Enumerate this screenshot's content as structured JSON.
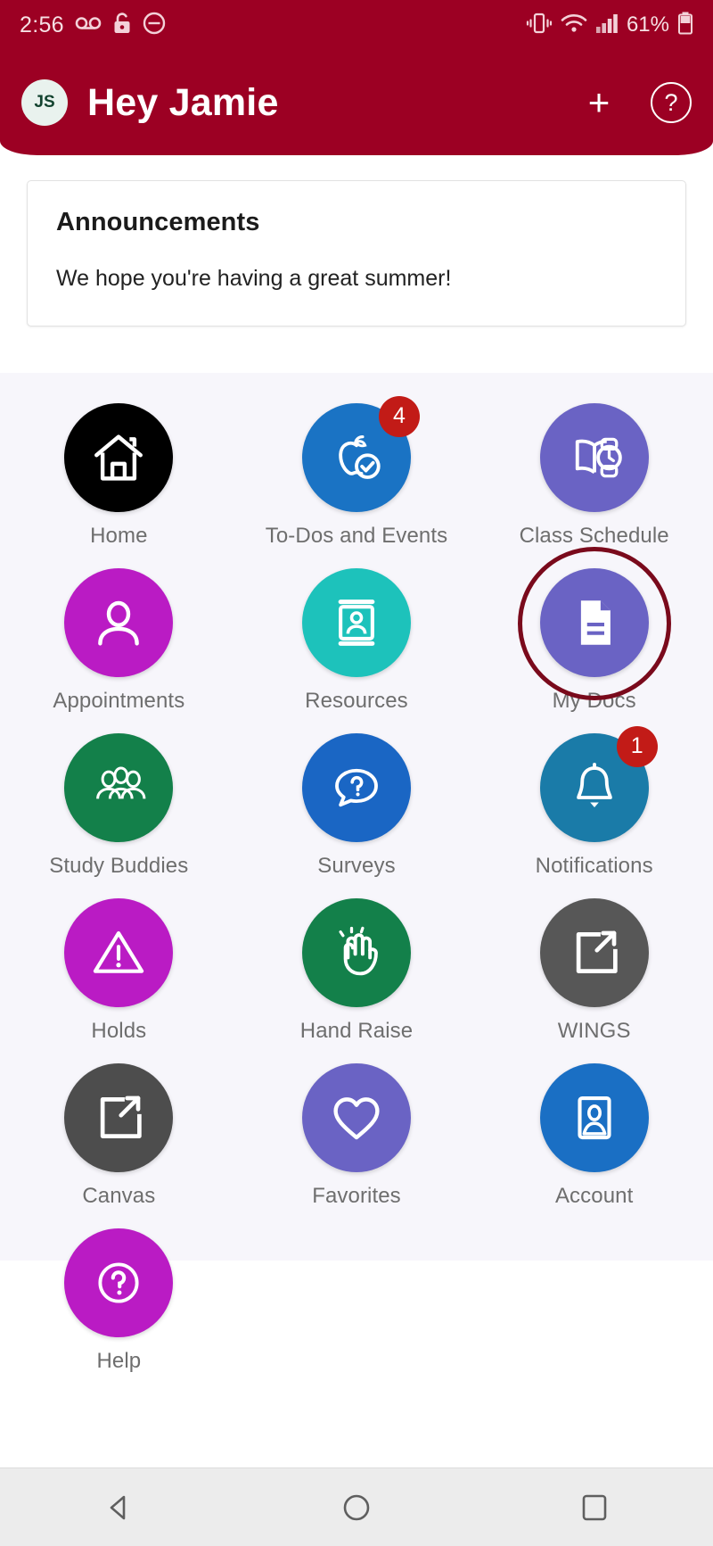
{
  "status_bar": {
    "time": "2:56",
    "battery_percent": "61%",
    "icons": [
      "voicemail-icon",
      "lock-icon",
      "do-not-disturb-icon",
      "vibrate-icon",
      "wifi-icon",
      "cellular-signal-icon",
      "battery-icon"
    ]
  },
  "app_bar": {
    "avatar_initials": "JS",
    "title": "Hey Jamie",
    "add_label": "+",
    "help_label": "?",
    "background_color": "#9c0023"
  },
  "announcements": {
    "title": "Announcements",
    "message": "We hope you're having a great summer!"
  },
  "grid": {
    "tiles": [
      {
        "label": "Home",
        "icon": "home-icon",
        "color": "#000000",
        "badge": null
      },
      {
        "label": "To-Dos and Events",
        "icon": "apple-check-icon",
        "color": "#1a73c4",
        "badge": "4"
      },
      {
        "label": "Class Schedule",
        "icon": "book-clock-icon",
        "color": "#6a63c4",
        "badge": null
      },
      {
        "label": "Appointments",
        "icon": "person-icon",
        "color": "#ba1bc4",
        "badge": null
      },
      {
        "label": "Resources",
        "icon": "id-card-icon",
        "color": "#1dc2bb",
        "badge": null
      },
      {
        "label": "My Docs",
        "icon": "document-icon",
        "color": "#6a63c4",
        "badge": null,
        "highlighted": true
      },
      {
        "label": "Study Buddies",
        "icon": "people-group-icon",
        "color": "#13804a",
        "badge": null
      },
      {
        "label": "Surveys",
        "icon": "speech-question-icon",
        "color": "#1a66c4",
        "badge": null
      },
      {
        "label": "Notifications",
        "icon": "bell-icon",
        "color": "#1a7ba8",
        "badge": "1"
      },
      {
        "label": "Holds",
        "icon": "warning-triangle-icon",
        "color": "#ba1bc4",
        "badge": null
      },
      {
        "label": "Hand Raise",
        "icon": "waving-hand-icon",
        "color": "#13804a",
        "badge": null
      },
      {
        "label": "WINGS",
        "icon": "external-link-icon",
        "color": "#575757",
        "badge": null
      },
      {
        "label": "Canvas",
        "icon": "external-link-icon",
        "color": "#4d4d4d",
        "badge": null
      },
      {
        "label": "Favorites",
        "icon": "heart-icon",
        "color": "#6a63c4",
        "badge": null
      },
      {
        "label": "Account",
        "icon": "portrait-card-icon",
        "color": "#1a6fc4",
        "badge": null
      },
      {
        "label": "Help",
        "icon": "question-circle-icon",
        "color": "#ba1bc4",
        "badge": null
      }
    ],
    "highlight_color": "#7a0a1c",
    "badge_color": "#c21b17",
    "background_color": "#f7f6fb"
  },
  "nav_bar": {
    "back_label": "back-icon",
    "home_label": "home-circle-icon",
    "recents_label": "recents-square-icon"
  }
}
